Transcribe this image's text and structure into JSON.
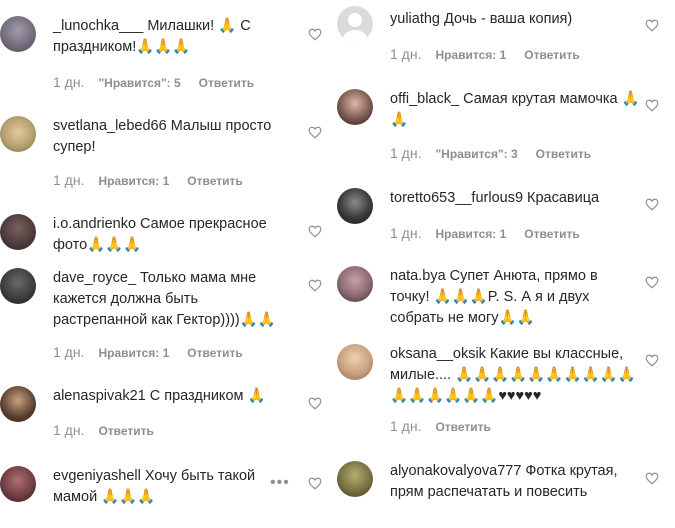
{
  "left": [
    {
      "user": "_lunochka___",
      "text": "Милашки! 🙏 С праздником!🙏🙏🙏",
      "time": "1 дн.",
      "likes": "\"Нравится\": 5",
      "reply": "Ответить",
      "avatar_bg": "#6e6a7a"
    },
    {
      "user": "svetlana_lebed66",
      "text": "Малыш просто супер!",
      "time": "1 дн.",
      "likes": "Нравится: 1",
      "reply": "Ответить",
      "avatar_bg": "#b8a070"
    },
    {
      "user": "i.o.andrienko",
      "text": "Самое прекрасное фото🙏🙏🙏",
      "time": "",
      "likes": "",
      "reply": "",
      "avatar_bg": "#4a3a3a"
    },
    {
      "user": "dave_royce_",
      "text": "Только мама мне кажется должна быть растрепанной как Гектор))))🙏🙏",
      "time": "1 дн.",
      "likes": "Нравится: 1",
      "reply": "Ответить",
      "avatar_bg": "#3a3a3a"
    },
    {
      "user": "alenaspivak21",
      "text": "С праздником 🙏",
      "time": "1 дн.",
      "likes": "",
      "reply": "Ответить",
      "avatar_bg": "#5a4030"
    },
    {
      "user": "evgeniyashell",
      "text": "Хочу быть такой мамой 🙏🙏🙏",
      "time": "",
      "likes": "",
      "reply": "",
      "avatar_bg": "#6a3a40"
    }
  ],
  "right": [
    {
      "user": "yuliathg",
      "text": "Дочь - ваша копия)",
      "time": "1 дн.",
      "likes": "Нравится: 1",
      "reply": "Ответить",
      "avatar_bg": "#dbdbdb"
    },
    {
      "user": "offi_black_",
      "text": "Самая крутая мамочка 🙏🙏",
      "time": "1 дн.",
      "likes": "\"Нравится\": 3",
      "reply": "Ответить",
      "avatar_bg": "#7a5a50"
    },
    {
      "user": "toretto653__furlous9",
      "text": "Красавица",
      "time": "1 дн.",
      "likes": "Нравится: 1",
      "reply": "Ответить",
      "avatar_bg": "#2a2a2a"
    },
    {
      "user": "nata.bya",
      "text": "Супет Анюта, прямо в точку! 🙏🙏🙏P. S. А я и двух собрать не могу🙏🙏",
      "time": "",
      "likes": "",
      "reply": "",
      "avatar_bg": "#8a6a70"
    },
    {
      "user": "oksana__oksik",
      "text": "Какие вы классные, милые.... 🙏🙏🙏🙏🙏🙏🙏🙏🙏🙏🙏🙏🙏🙏🙏🙏♥♥♥♥♥",
      "time": "1 дн.",
      "likes": "",
      "reply": "Ответить",
      "avatar_bg": "#c8a080"
    },
    {
      "user": "alyonakovalyova777",
      "text": "Фотка крутая, прям распечатать и повесить",
      "time": "",
      "likes": "",
      "reply": "",
      "avatar_bg": "#7a7040"
    }
  ],
  "more_icon": "more-dots-icon",
  "heart_icon": "heart-outline-icon",
  "avatar_icon": "default-avatar-icon"
}
